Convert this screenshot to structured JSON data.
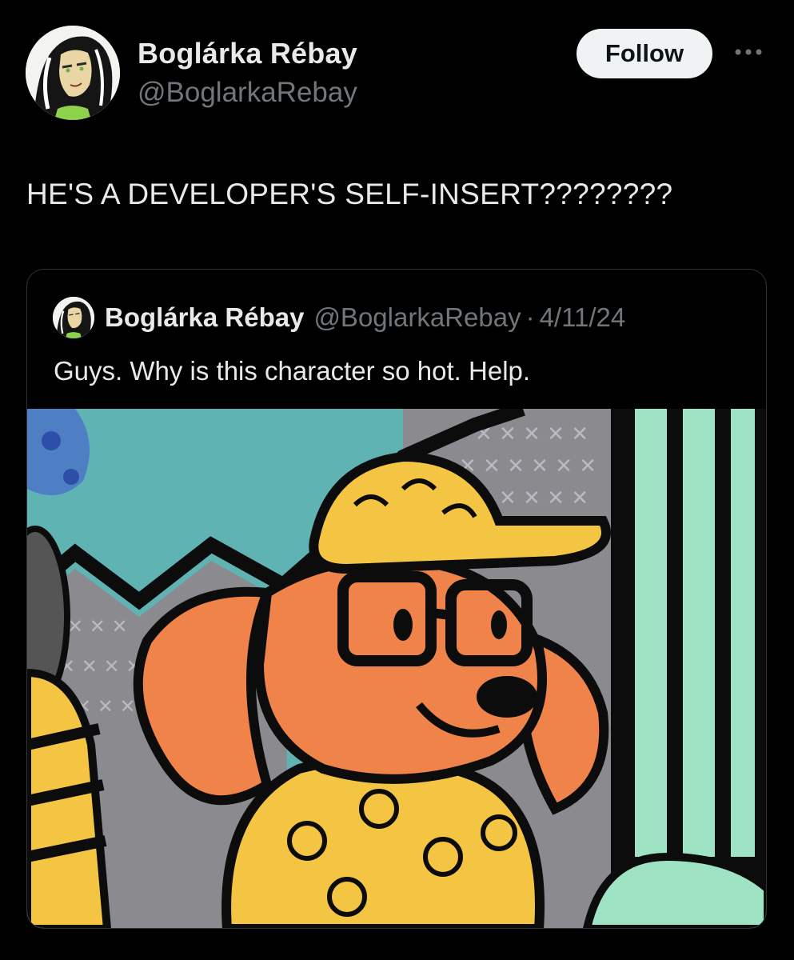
{
  "post": {
    "author": {
      "display_name": "Boglárka Rébay",
      "handle": "@BoglarkaRebay"
    },
    "follow_label": "Follow",
    "more_icon": "more-horizontal-icon",
    "text": "HE'S A DEVELOPER'S SELF-INSERT????????"
  },
  "quoted_post": {
    "author": {
      "display_name": "Boglárka Rébay",
      "handle": "@BoglarkaRebay"
    },
    "separator": "·",
    "date": "4/11/24",
    "text": "Guys. Why is this character so hot. Help.",
    "media": "cartoon-orange-dog-character-image"
  },
  "colors": {
    "background": "#000000",
    "primary_text": "#e7e9ea",
    "secondary_text": "#71767b",
    "border": "#2f3336",
    "follow_button_bg": "#eff3f4"
  }
}
